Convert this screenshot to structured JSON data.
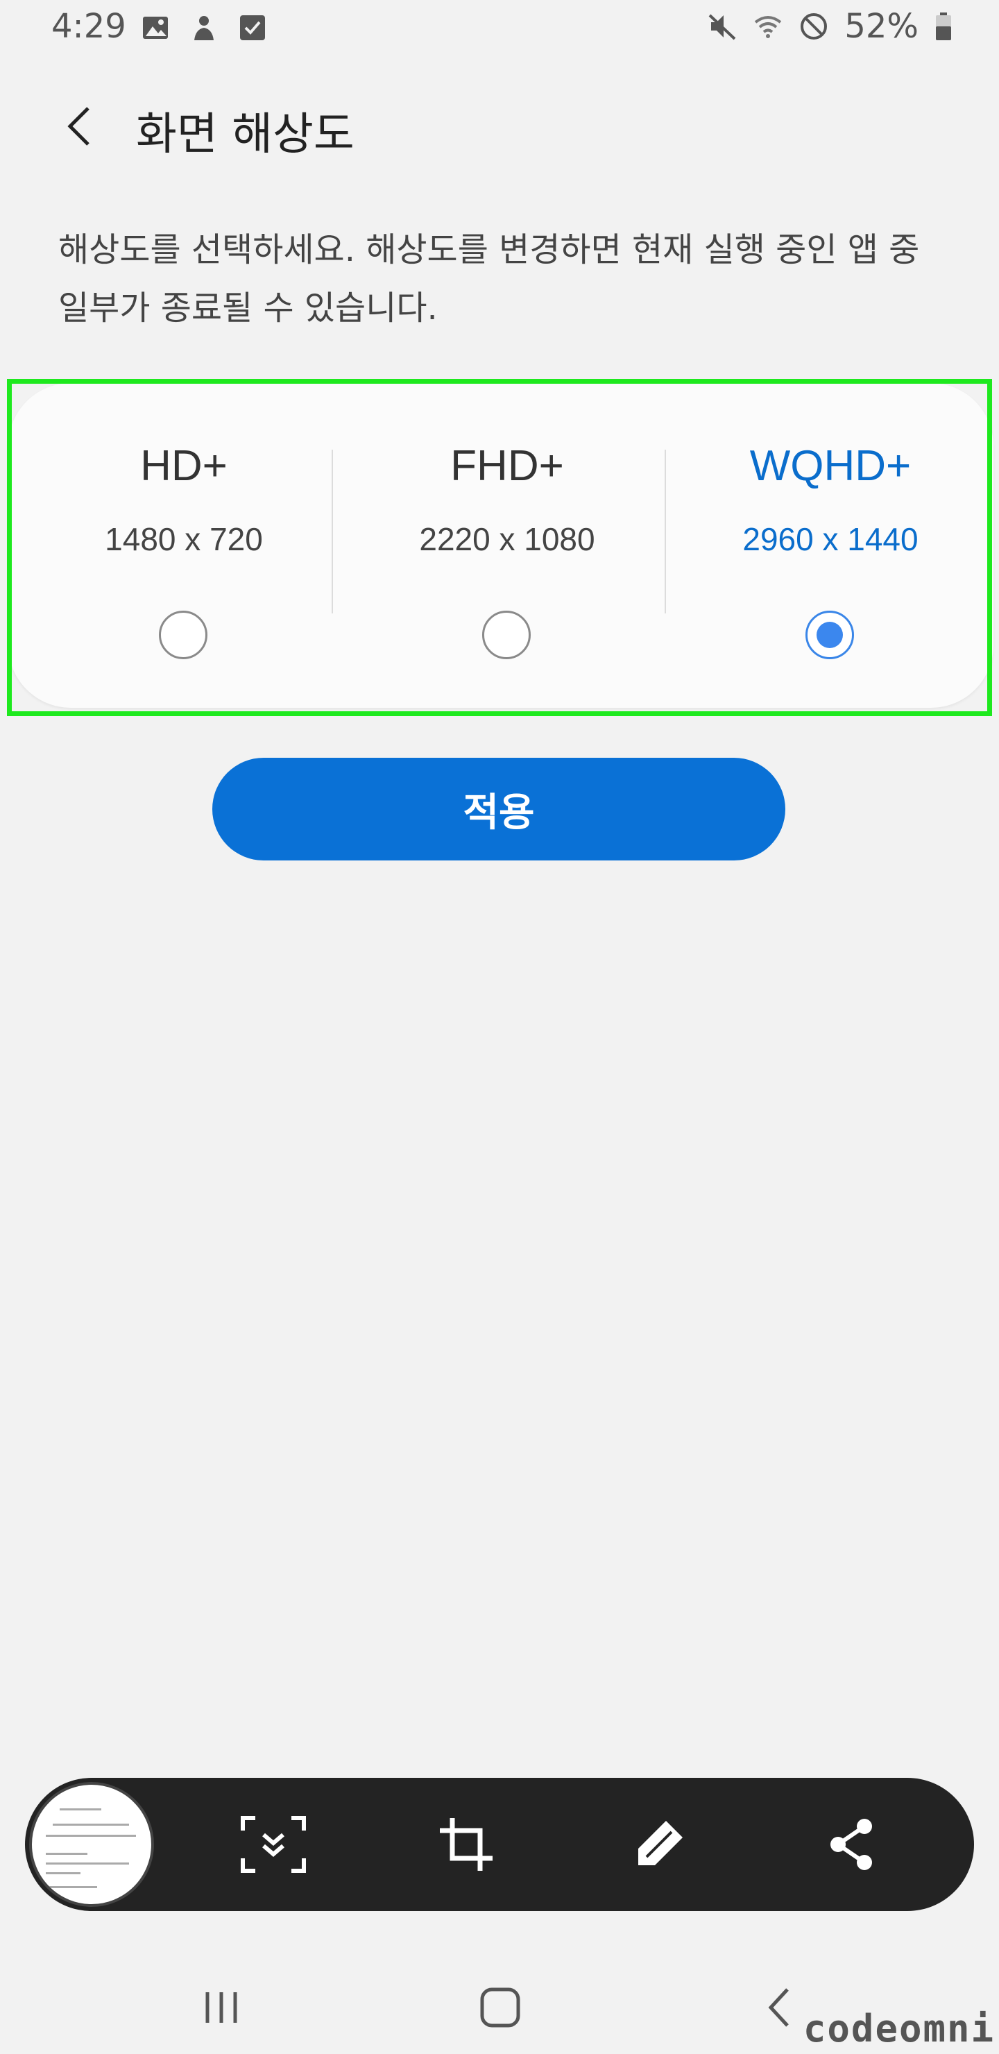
{
  "status_bar": {
    "time": "4:29",
    "left_icons": [
      "image-icon",
      "account-icon",
      "checkbox-icon"
    ],
    "right_icons": [
      "mute-icon",
      "wifi-icon",
      "do-not-disturb-icon"
    ],
    "battery": "52%"
  },
  "header": {
    "back_icon": "chevron-left-icon",
    "title": "화면 해상도"
  },
  "description": "해상도를 선택하세요. 해상도를 변경하면 현재 실행 중인 앱 중 일부가 종료될 수 있습니다.",
  "resolutions": [
    {
      "name": "HD+",
      "size": "1480 x 720",
      "selected": false
    },
    {
      "name": "FHD+",
      "size": "2220 x 1080",
      "selected": false
    },
    {
      "name": "WQHD+",
      "size": "2960 x 1440",
      "selected": true
    }
  ],
  "apply_label": "적용",
  "screenshot_toolbar": {
    "tools": [
      "scroll-capture-icon",
      "crop-icon",
      "draw-icon",
      "share-icon"
    ]
  },
  "nav_bar": {
    "buttons": [
      "recent-apps-icon",
      "home-icon",
      "back-icon"
    ]
  },
  "watermark": "codeomni",
  "colors": {
    "accent": "#0a71d6",
    "selected_text": "#0a6dcc",
    "highlight": "#1ee91e",
    "toolbar_bg": "#232323"
  }
}
